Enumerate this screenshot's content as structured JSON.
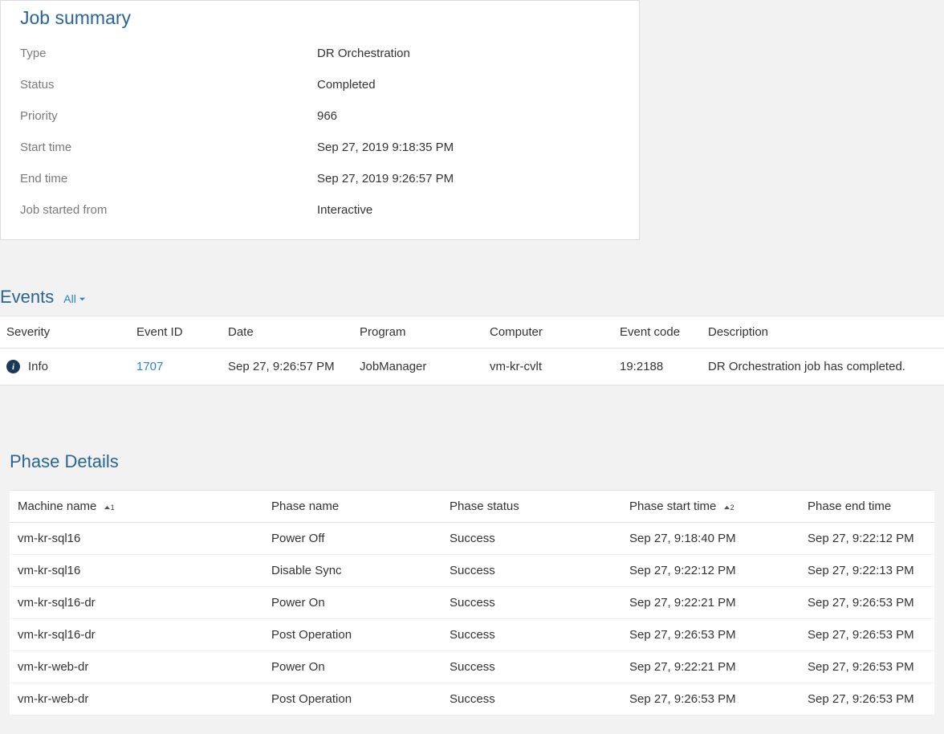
{
  "jobSummary": {
    "title": "Job summary",
    "rows": [
      {
        "label": "Type",
        "value": "DR Orchestration"
      },
      {
        "label": "Status",
        "value": "Completed"
      },
      {
        "label": "Priority",
        "value": "966"
      },
      {
        "label": "Start time",
        "value": "Sep 27, 2019 9:18:35 PM"
      },
      {
        "label": "End time",
        "value": "Sep 27, 2019 9:26:57 PM"
      },
      {
        "label": "Job started from",
        "value": "Interactive"
      }
    ]
  },
  "events": {
    "title": "Events",
    "filterLabel": "All",
    "headers": [
      "Severity",
      "Event ID",
      "Date",
      "Program",
      "Computer",
      "Event code",
      "Description"
    ],
    "rows": [
      {
        "severity": "Info",
        "eventId": "1707",
        "date": "Sep 27, 9:26:57 PM",
        "program": "JobManager",
        "computer": "vm-kr-cvlt",
        "eventCode": "19:2188",
        "description": "DR Orchestration job has completed."
      }
    ]
  },
  "phaseDetails": {
    "title": "Phase Details",
    "headers": {
      "machineName": "Machine name",
      "phaseName": "Phase name",
      "phaseStatus": "Phase status",
      "phaseStartTime": "Phase start time",
      "phaseEndTime": "Phase end time"
    },
    "sortIndicators": {
      "machineName": "1",
      "phaseStartTime": "2"
    },
    "rows": [
      {
        "machineName": "vm-kr-sql16",
        "phaseName": "Power Off",
        "phaseStatus": "Success",
        "phaseStartTime": "Sep 27, 9:18:40 PM",
        "phaseEndTime": "Sep 27, 9:22:12 PM"
      },
      {
        "machineName": "vm-kr-sql16",
        "phaseName": "Disable Sync",
        "phaseStatus": "Success",
        "phaseStartTime": "Sep 27, 9:22:12 PM",
        "phaseEndTime": "Sep 27, 9:22:13 PM"
      },
      {
        "machineName": "vm-kr-sql16-dr",
        "phaseName": "Power On",
        "phaseStatus": "Success",
        "phaseStartTime": "Sep 27, 9:22:21 PM",
        "phaseEndTime": "Sep 27, 9:26:53 PM"
      },
      {
        "machineName": "vm-kr-sql16-dr",
        "phaseName": "Post Operation",
        "phaseStatus": "Success",
        "phaseStartTime": "Sep 27, 9:26:53 PM",
        "phaseEndTime": "Sep 27, 9:26:53 PM"
      },
      {
        "machineName": "vm-kr-web-dr",
        "phaseName": "Power On",
        "phaseStatus": "Success",
        "phaseStartTime": "Sep 27, 9:22:21 PM",
        "phaseEndTime": "Sep 27, 9:26:53 PM"
      },
      {
        "machineName": "vm-kr-web-dr",
        "phaseName": "Post Operation",
        "phaseStatus": "Success",
        "phaseStartTime": "Sep 27, 9:26:53 PM",
        "phaseEndTime": "Sep 27, 9:26:53 PM"
      }
    ]
  }
}
